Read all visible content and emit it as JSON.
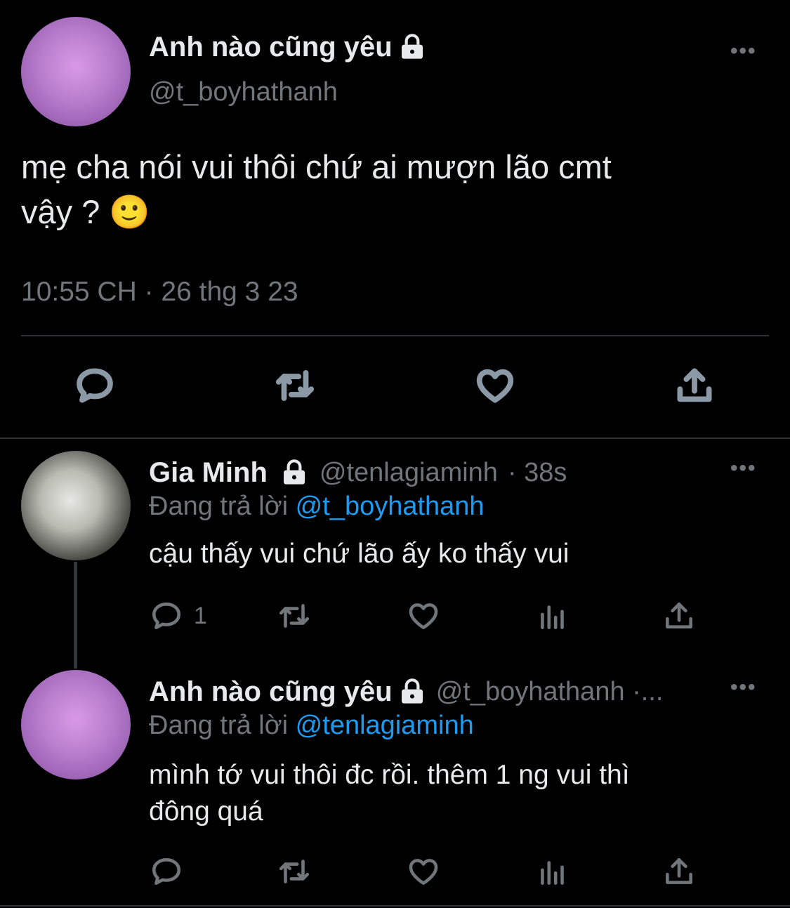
{
  "main_tweet": {
    "display_name": "Anh nào cũng yêu",
    "handle": "@t_boyhathanh",
    "text_line1": "mẹ cha nói vui thôi chứ ai mượn lão cmt",
    "text_line2": "vậy ?",
    "emoji": "🙂",
    "timestamp": "10:55 CH · 26 thg 3 23",
    "more_label": "•••"
  },
  "reply1": {
    "display_name": "Gia Minh",
    "handle": "@tenlagiaminh",
    "time": "· 38s",
    "replying_prefix": "Đang trả lời",
    "replying_to": "@t_boyhathanh",
    "text": "cậu thấy vui chứ lão ấy ko thấy vui",
    "reply_count": "1",
    "more_label": "•••"
  },
  "reply2": {
    "display_name": "Anh nào cũng yêu",
    "handle": "@t_boyhathanh ·...",
    "replying_prefix": "Đang trả lời",
    "replying_to": "@tenlagiaminh",
    "text_line1": "mình tớ vui thôi đc rồi. thêm 1 ng vui thì",
    "text_line2": "đông quá",
    "more_label": "•••"
  },
  "icons": [
    "lock-icon",
    "reply-icon",
    "retweet-icon",
    "like-icon",
    "share-icon",
    "views-icon",
    "more-icon"
  ],
  "colors": {
    "background": "#000000",
    "text": "#e7e9ea",
    "muted": "#71767b",
    "link": "#1d9bf0"
  }
}
